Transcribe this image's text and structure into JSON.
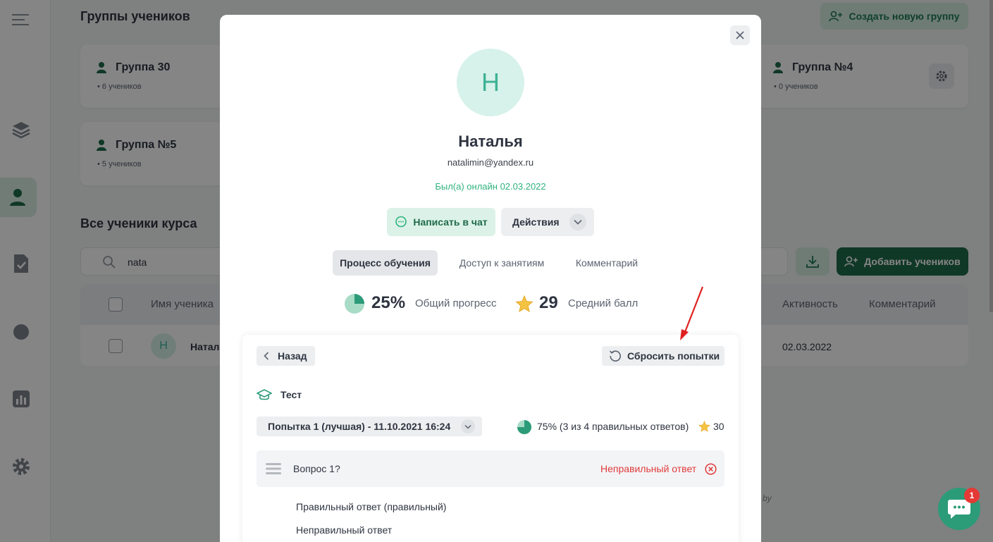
{
  "background": {
    "groups_title": "Группы учеников",
    "create_group_label": "Создать новую группу",
    "groups": [
      {
        "name": "Группа 30",
        "count": "6 учеников"
      },
      {
        "name": "Группа №4",
        "count": "0 учеников"
      },
      {
        "name": "Группа №5",
        "count": "5 учеников"
      }
    ],
    "all_students_title": "Все ученики курса",
    "search_value": "nata",
    "add_students_label": "Добавить учеников",
    "table": {
      "columns": [
        "Имя ученика",
        "Активность",
        "Комментарий"
      ],
      "row": {
        "avatar": "Н",
        "name": "Натал",
        "activity": "02.03.2022"
      }
    },
    "watermark": "by"
  },
  "modal": {
    "avatar_letter": "Н",
    "name": "Наталья",
    "email": "natalimin@yandex.ru",
    "online_status": "Был(а) онлайн 02.03.2022",
    "chat_button": "Написать в чат",
    "actions_button": "Действия",
    "tabs": [
      {
        "label": "Процесс обучения",
        "active": true
      },
      {
        "label": "Доступ к занятиям",
        "active": false
      },
      {
        "label": "Комментарий",
        "active": false
      }
    ],
    "stats": {
      "progress_value": "25%",
      "progress_fraction": 0.25,
      "progress_label": "Общий прогресс",
      "avg_score_value": "29",
      "avg_score_label": "Средний балл"
    },
    "panel": {
      "back_button": "Назад",
      "reset_button": "Сбросить попытки",
      "test_title": "Тест",
      "attempt_select": "Попытка 1 (лучшая) - 11.10.2021 16:24",
      "result": "75% (3 из 4 правильных ответов)",
      "result_fraction": 0.75,
      "score": "30",
      "question": {
        "title": "Вопрос 1?",
        "status": "Неправильный ответ"
      },
      "answers": [
        "Правильный ответ (правильный)",
        "Неправильный ответ"
      ]
    }
  },
  "chat_widget": {
    "badge": "1"
  },
  "colors": {
    "accent": "#2fb37e",
    "accent_dark": "#1f6b4a",
    "error": "#e03b3b",
    "avatar_bg": "#d7f2ea",
    "annotation_arrow": "#e02020"
  }
}
